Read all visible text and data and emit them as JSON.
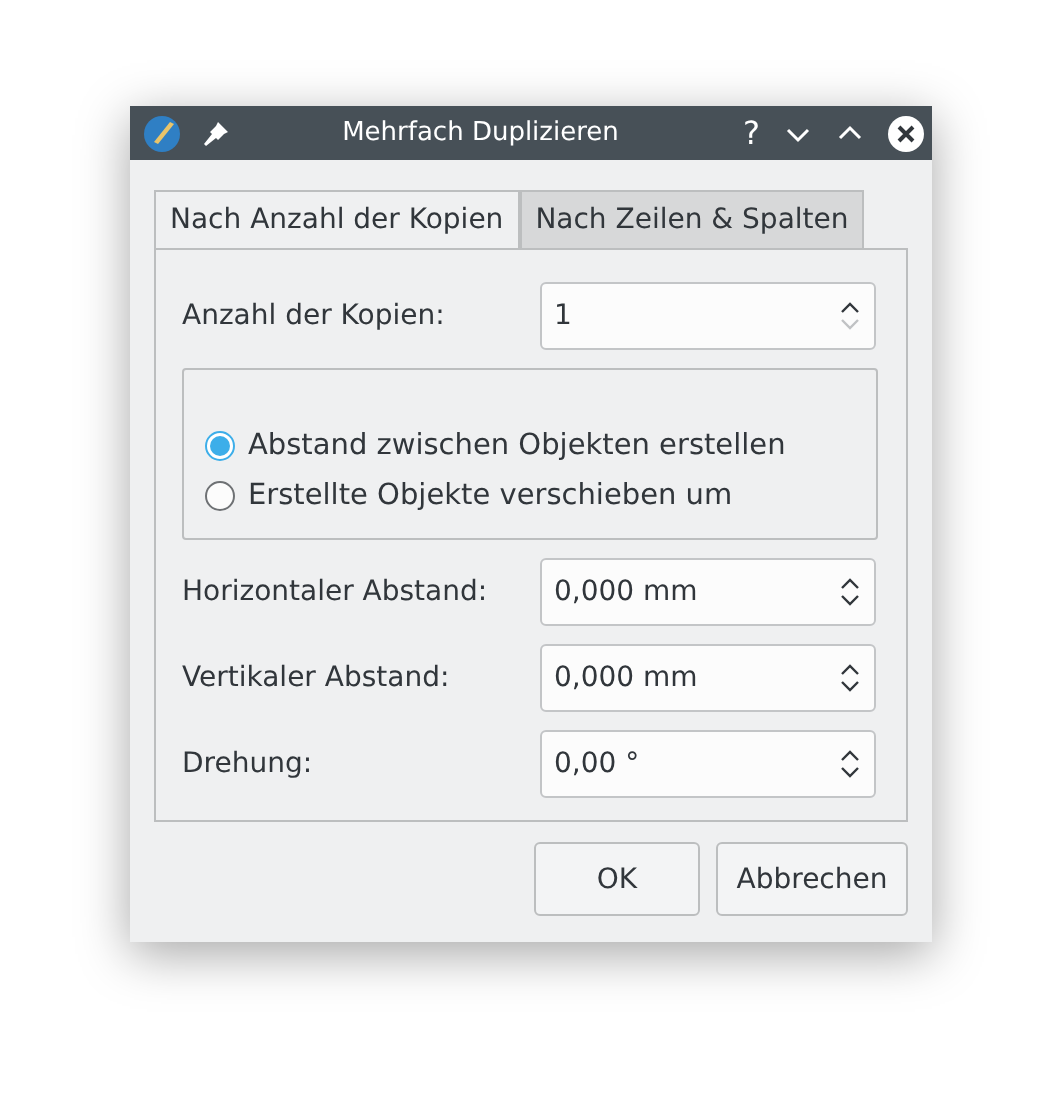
{
  "window": {
    "title": "Mehrfach Duplizieren"
  },
  "titlebar_buttons": [
    {
      "kind": "help",
      "label": "?"
    },
    {
      "kind": "minimize"
    },
    {
      "kind": "maximize"
    },
    {
      "kind": "close"
    }
  ],
  "tabs": [
    {
      "label": "Nach Anzahl der Kopien",
      "selected": true
    },
    {
      "label": "Nach Zeilen & Spalten",
      "selected": false
    }
  ],
  "copies": {
    "label": "Anzahl der Kopien:",
    "value": "1",
    "down_disabled": true
  },
  "options": [
    {
      "label": "Abstand zwischen Objekten erstellen",
      "selected": true
    },
    {
      "label": "Erstellte Objekte verschieben um",
      "selected": false
    }
  ],
  "fields": [
    {
      "label": "Horizontaler Abstand:",
      "value": "0,000 mm",
      "down_disabled": false
    },
    {
      "label": "Vertikaler Abstand:",
      "value": "0,000 mm",
      "down_disabled": false
    },
    {
      "label": "Drehung:",
      "value": "0,00 °",
      "down_disabled": false
    }
  ],
  "buttons": [
    "OK",
    "Abbrechen"
  ]
}
